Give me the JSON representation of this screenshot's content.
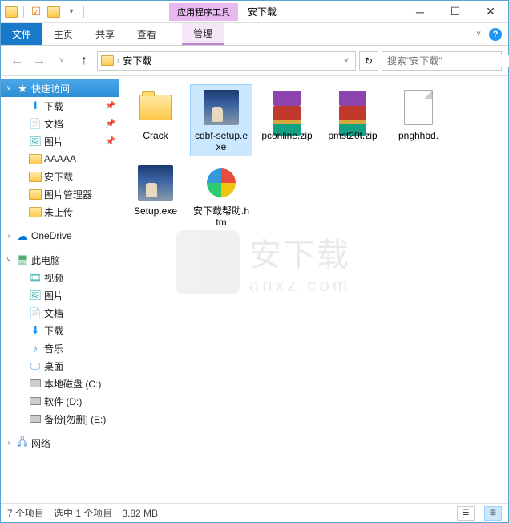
{
  "titlebar": {
    "context_tab": "应用程序工具",
    "title": "安下载"
  },
  "ribbon": {
    "file": "文件",
    "tabs": [
      "主页",
      "共享",
      "查看"
    ],
    "context": "管理"
  },
  "nav": {
    "path_segments": [
      "安下载"
    ],
    "search_placeholder": "搜索\"安下载\""
  },
  "sidebar": {
    "quick_access": "快速访问",
    "quick_items": [
      {
        "label": "下载",
        "icon": "download",
        "pinned": true
      },
      {
        "label": "文档",
        "icon": "document",
        "pinned": true
      },
      {
        "label": "图片",
        "icon": "picture",
        "pinned": true
      },
      {
        "label": "AAAAA",
        "icon": "folder",
        "pinned": false
      },
      {
        "label": "安下载",
        "icon": "folder",
        "pinned": false
      },
      {
        "label": "图片管理器",
        "icon": "folder",
        "pinned": false
      },
      {
        "label": "未上传",
        "icon": "folder",
        "pinned": false
      }
    ],
    "onedrive": "OneDrive",
    "this_pc": "此电脑",
    "pc_items": [
      {
        "label": "视频",
        "icon": "video"
      },
      {
        "label": "图片",
        "icon": "picture"
      },
      {
        "label": "文档",
        "icon": "document"
      },
      {
        "label": "下载",
        "icon": "download"
      },
      {
        "label": "音乐",
        "icon": "music"
      },
      {
        "label": "桌面",
        "icon": "desktop"
      },
      {
        "label": "本地磁盘 (C:)",
        "icon": "disk"
      },
      {
        "label": "软件 (D:)",
        "icon": "disk"
      },
      {
        "label": "备份[勿删] (E:)",
        "icon": "disk"
      }
    ],
    "network": "网络"
  },
  "files": [
    {
      "name": "Crack",
      "type": "folder",
      "selected": false
    },
    {
      "name": "cdbf-setup.exe",
      "type": "exe",
      "selected": true
    },
    {
      "name": "pconline.zip",
      "type": "zip",
      "selected": false
    },
    {
      "name": "pmst20t.zip",
      "type": "zip",
      "selected": false
    },
    {
      "name": "pnghhbd.",
      "type": "blank",
      "selected": false
    },
    {
      "name": "Setup.exe",
      "type": "exe",
      "selected": false
    },
    {
      "name": "安下载帮助.htm",
      "type": "htm",
      "selected": false
    }
  ],
  "watermark": {
    "text": "安下载",
    "sub": "anxz.com"
  },
  "statusbar": {
    "count": "7 个项目",
    "selected": "选中 1 个项目",
    "size": "3.82 MB"
  }
}
